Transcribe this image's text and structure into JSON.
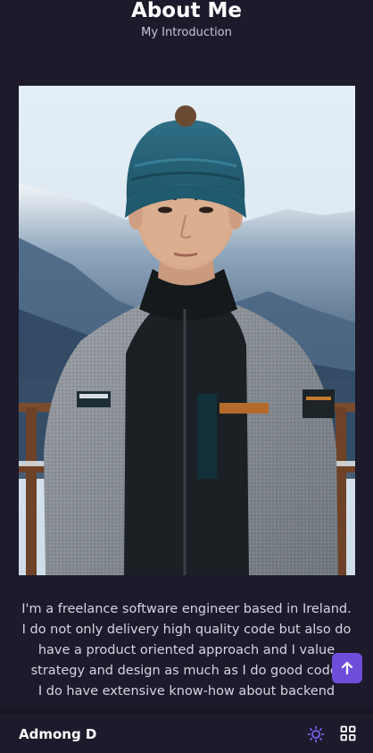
{
  "section": {
    "title": "About Me",
    "subtitle": "My Introduction"
  },
  "about": {
    "paragraph_1": "I'm a freelance software engineer based in Ireland.",
    "paragraph_2": "I do not only delivery high quality code but also do have a product oriented approach and I value strategy and design as much as I do good code.",
    "paragraph_3": "I do have extensive know-how about backend"
  },
  "footer": {
    "brand": "Admong D",
    "theme_icon": "sun-icon",
    "menu_icon": "grid-menu-icon"
  },
  "scroll_top": {
    "icon": "arrow-up-icon"
  },
  "colors": {
    "background": "#1c1a2b",
    "accent": "#6e4ed9",
    "text": "#d6d3e3"
  }
}
